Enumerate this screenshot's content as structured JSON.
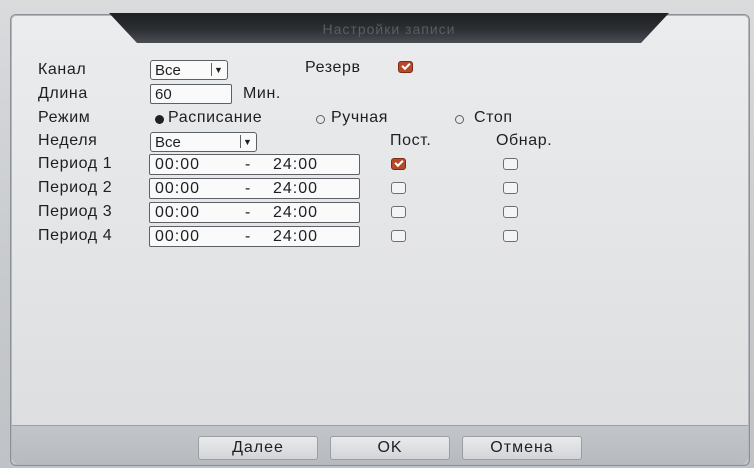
{
  "title": "Настройки записи",
  "fields": {
    "channel": {
      "label": "Канал",
      "value": "Все"
    },
    "redundancy": {
      "label": "Резерв",
      "checked": true
    },
    "length": {
      "label": "Длина",
      "value": "60",
      "unit": "Мин."
    },
    "mode": {
      "label": "Режим",
      "options": [
        "Расписание",
        "Ручная",
        "Стоп"
      ],
      "selected": "Расписание"
    },
    "week": {
      "label": "Неделя",
      "value": "Все"
    }
  },
  "columns": {
    "constant": "Пост.",
    "detect": "Обнар."
  },
  "periods": [
    {
      "label": "Период 1",
      "start": "00:00",
      "sep": "-",
      "end": "24:00",
      "constant": true,
      "detect": false
    },
    {
      "label": "Период 2",
      "start": "00:00",
      "sep": "-",
      "end": "24:00",
      "constant": false,
      "detect": false
    },
    {
      "label": "Период 3",
      "start": "00:00",
      "sep": "-",
      "end": "24:00",
      "constant": false,
      "detect": false
    },
    {
      "label": "Период 4",
      "start": "00:00",
      "sep": "-",
      "end": "24:00",
      "constant": false,
      "detect": false
    }
  ],
  "buttons": {
    "next": "Далее",
    "ok": "OK",
    "cancel": "Отмена"
  },
  "icons": {
    "dropdown": "chevron-down-icon",
    "checkbox_checked": "check-icon"
  },
  "colors": {
    "check_accent": "#b34b2a",
    "title_bar": "#2c2f33"
  }
}
